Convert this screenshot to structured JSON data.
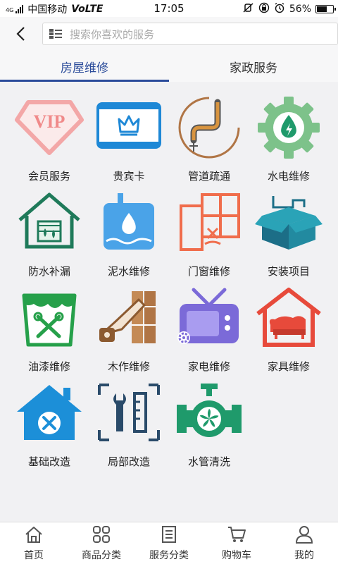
{
  "status_bar": {
    "carrier": "中国移动",
    "network": "VoLTE",
    "signal_type": "4G",
    "time": "17:05",
    "battery": "56%"
  },
  "header": {
    "back_icon": "chevron-left-icon",
    "search_placeholder": "搜索你喜欢的服务"
  },
  "tabs": [
    {
      "label": "房屋维修",
      "active": true
    },
    {
      "label": "家政服务",
      "active": false
    }
  ],
  "services": [
    {
      "label": "会员服务",
      "icon": "vip-icon"
    },
    {
      "label": "贵宾卡",
      "icon": "crown-card-icon"
    },
    {
      "label": "管道疏通",
      "icon": "pipe-icon"
    },
    {
      "label": "水电维修",
      "icon": "gear-drop-icon"
    },
    {
      "label": "防水补漏",
      "icon": "house-waterproof-icon"
    },
    {
      "label": "泥水维修",
      "icon": "water-drop-tank-icon"
    },
    {
      "label": "门窗维修",
      "icon": "window-icon"
    },
    {
      "label": "安装项目",
      "icon": "box-install-icon"
    },
    {
      "label": "油漆维修",
      "icon": "paint-bucket-icon"
    },
    {
      "label": "木作维修",
      "icon": "chainsaw-icon"
    },
    {
      "label": "家电维修",
      "icon": "tv-icon"
    },
    {
      "label": "家具维修",
      "icon": "sofa-house-icon"
    },
    {
      "label": "基础改造",
      "icon": "house-tools-icon"
    },
    {
      "label": "局部改造",
      "icon": "wrench-ruler-icon"
    },
    {
      "label": "水管清洗",
      "icon": "valve-fan-icon"
    }
  ],
  "bottom_nav": [
    {
      "label": "首页",
      "icon": "home-icon"
    },
    {
      "label": "商品分类",
      "icon": "grid-icon"
    },
    {
      "label": "服务分类",
      "icon": "document-icon"
    },
    {
      "label": "购物车",
      "icon": "cart-icon"
    },
    {
      "label": "我的",
      "icon": "user-icon"
    }
  ],
  "colors": {
    "accent": "#2a4b9a",
    "background": "#f1f1f3"
  }
}
